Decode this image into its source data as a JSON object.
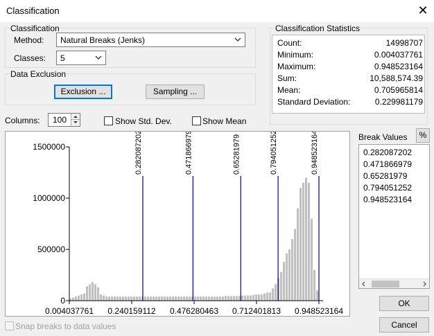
{
  "window": {
    "title": "Classification",
    "close_glyph": "✕"
  },
  "classification": {
    "group_label": "Classification",
    "method_label": "Method:",
    "method_value": "Natural Breaks (Jenks)",
    "classes_label": "Classes:",
    "classes_value": "5"
  },
  "exclusion": {
    "group_label": "Data Exclusion",
    "exclusion_button": "Exclusion ...",
    "sampling_button": "Sampling ..."
  },
  "stats": {
    "group_label": "Classification Statistics",
    "rows": [
      {
        "key": "Count:",
        "value": "14998707"
      },
      {
        "key": "Minimum:",
        "value": "0.004037761"
      },
      {
        "key": "Maximum:",
        "value": "0.948523164"
      },
      {
        "key": "Sum:",
        "value": "10,588,574.39"
      },
      {
        "key": "Mean:",
        "value": "0.705965814"
      },
      {
        "key": "Standard Deviation:",
        "value": "0.229981179"
      }
    ]
  },
  "options": {
    "columns_label": "Columns:",
    "columns_value": "100",
    "show_std_dev": "Show Std. Dev.",
    "show_mean": "Show Mean",
    "snap_breaks": "Snap breaks to data values"
  },
  "break_values": {
    "label": "Break Values",
    "percent_button": "%",
    "values": [
      "0.282087202",
      "0.471866979",
      "0.65281979",
      "0.794051252",
      "0.948523164"
    ]
  },
  "buttons": {
    "ok": "OK",
    "cancel": "Cancel"
  },
  "chart_data": {
    "type": "bar",
    "x_min": 0.004037761,
    "x_max": 0.948523164,
    "ylim": [
      0,
      1500000
    ],
    "y_ticks": [
      "1500000",
      "1000000",
      "500000",
      "0"
    ],
    "x_ticks": [
      "0.004037761",
      "0.240159112",
      "0.476280463",
      "0.712401813",
      "0.948523164"
    ],
    "breaks": [
      "0.282087202",
      "0.471866979",
      "0.65281979",
      "0.794051252",
      "0.948523164"
    ],
    "bar_color": "#c0c0c0",
    "break_line_color": "#00008b",
    "values": [
      20000,
      30000,
      40000,
      50000,
      60000,
      70000,
      140000,
      160000,
      180000,
      160000,
      130000,
      60000,
      50000,
      40000,
      40000,
      40000,
      40000,
      40000,
      40000,
      40000,
      40000,
      40000,
      40000,
      40000,
      40000,
      40000,
      40000,
      40000,
      40000,
      40000,
      40000,
      40000,
      40000,
      40000,
      40000,
      40000,
      40000,
      40000,
      40000,
      40000,
      40000,
      40000,
      40000,
      40000,
      40000,
      40000,
      40000,
      40000,
      40000,
      40000,
      40000,
      40000,
      40000,
      40000,
      40000,
      40000,
      45000,
      45000,
      45000,
      45000,
      45000,
      45000,
      50000,
      50000,
      50000,
      50000,
      55000,
      60000,
      60000,
      60000,
      70000,
      80000,
      80000,
      120000,
      160000,
      220000,
      280000,
      380000,
      460000,
      500000,
      600000,
      700000,
      900000,
      1100000,
      1150000,
      1200000,
      1150000,
      800000,
      300000,
      100000
    ]
  }
}
